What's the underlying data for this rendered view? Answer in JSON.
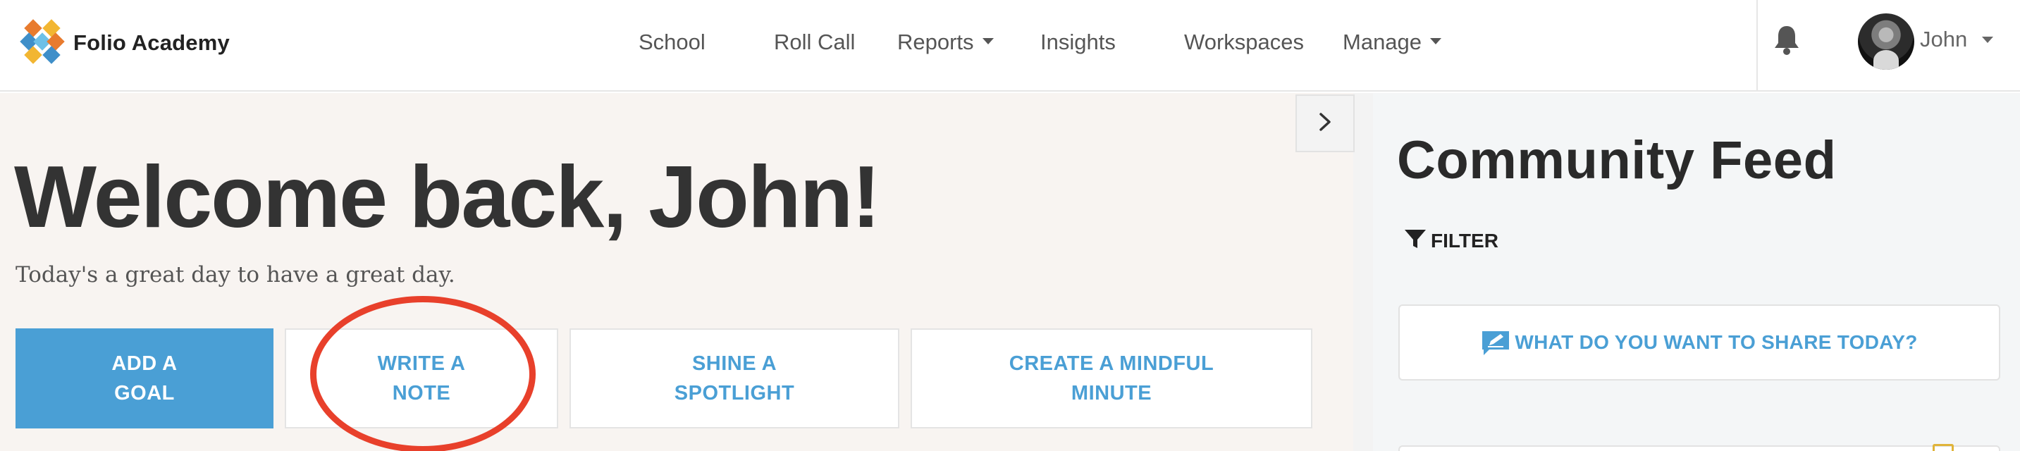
{
  "brand": {
    "name": "Folio Academy",
    "logo_icon": "folio-logo-icon"
  },
  "nav": {
    "items": [
      {
        "label": "School"
      },
      {
        "label": "Roll Call"
      },
      {
        "label": "Reports",
        "dropdown": true
      },
      {
        "label": "Insights"
      },
      {
        "label": "Workspaces"
      },
      {
        "label": "Manage",
        "dropdown": true
      }
    ],
    "notifications_icon": "bell-icon",
    "user": {
      "name": "John",
      "avatar_icon": "user-avatar"
    }
  },
  "main": {
    "welcome": "Welcome back, John!",
    "tagline": "Today's a great day to have a great day.",
    "actions": [
      {
        "label": "ADD A GOAL",
        "style": "primary"
      },
      {
        "label": "WRITE A NOTE",
        "style": "secondary",
        "highlighted": true
      },
      {
        "label": "SHINE A SPOTLIGHT",
        "style": "secondary"
      },
      {
        "label": "CREATE A MINDFUL MINUTE",
        "style": "secondary"
      }
    ]
  },
  "sidebar": {
    "toggle_icon": "chevron-right-icon",
    "title": "Community Feed",
    "filter_label": "FILTER",
    "filter_icon": "funnel-icon",
    "share_prompt": "WHAT DO YOU WANT TO SHARE TODAY?",
    "share_icon": "pencil-note-icon"
  },
  "colors": {
    "accent": "#4a9fd5",
    "main_background": "#f8f4f1",
    "sidebar_background": "#f4f6f7",
    "highlight_ring": "#e8402b",
    "text_dark": "#333333"
  }
}
